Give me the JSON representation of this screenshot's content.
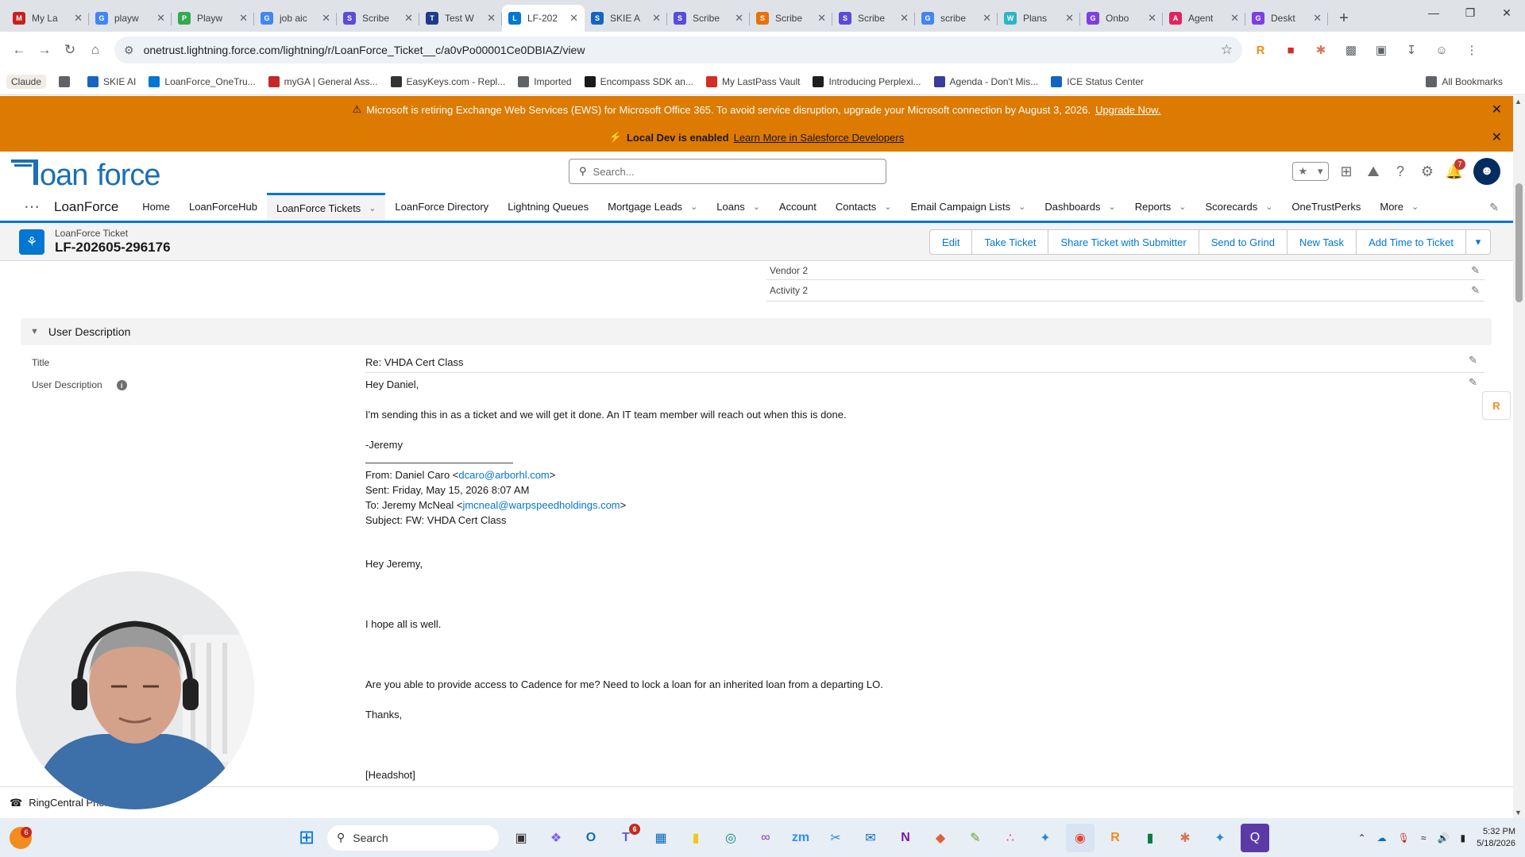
{
  "browser": {
    "tabs": [
      {
        "label": "My La",
        "color": "#c5221f",
        "glyph": "M"
      },
      {
        "label": "playw",
        "color": "#4285f4",
        "glyph": "G"
      },
      {
        "label": "Playw",
        "color": "#34a853",
        "glyph": "P"
      },
      {
        "label": "job aic",
        "color": "#4285f4",
        "glyph": "G"
      },
      {
        "label": "Scribe",
        "color": "#5b4bdb",
        "glyph": "S"
      },
      {
        "label": "Test W",
        "color": "#1e3a8a",
        "glyph": "T"
      },
      {
        "label": "LF-202",
        "color": "#0176d3",
        "glyph": "L",
        "active": true
      },
      {
        "label": "SKIE A",
        "color": "#1565c0",
        "glyph": "S"
      },
      {
        "label": "Scribe",
        "color": "#5b4bdb",
        "glyph": "S"
      },
      {
        "label": "Scribe",
        "color": "#e8710a",
        "glyph": "S"
      },
      {
        "label": "Scribe",
        "color": "#5b4bdb",
        "glyph": "S"
      },
      {
        "label": "scribe",
        "color": "#4285f4",
        "glyph": "G"
      },
      {
        "label": "Plans",
        "color": "#2bb5c9",
        "glyph": "W"
      },
      {
        "label": "Onbo",
        "color": "#7b3fe4",
        "glyph": "G"
      },
      {
        "label": "Agent",
        "color": "#e0245e",
        "glyph": "A"
      },
      {
        "label": "Deskt",
        "color": "#7b3fe4",
        "glyph": "G"
      }
    ],
    "url": "onetrust.lightning.force.com/lightning/r/LoanForce_Ticket__c/a0vPo00001Ce0DBIAZ/view",
    "bookmarks": [
      {
        "label": "Claude",
        "color": "#d97757"
      },
      {
        "label": "",
        "color": "#5f6368"
      },
      {
        "label": "SKIE AI",
        "color": "#1565c0"
      },
      {
        "label": "LoanForce_OneTru...",
        "color": "#0176d3"
      },
      {
        "label": "myGA | General Ass...",
        "color": "#c62828"
      },
      {
        "label": "EasyKeys.com - Repl...",
        "color": "#333333"
      },
      {
        "label": "Imported",
        "color": "#5f6368"
      },
      {
        "label": "Encompass SDK an...",
        "color": "#1a1a1a"
      },
      {
        "label": "My LastPass Vault",
        "color": "#d32d27"
      },
      {
        "label": "Introducing Perplexi...",
        "color": "#1f1f1f"
      },
      {
        "label": "Agenda - Don't Mis...",
        "color": "#3b3b98"
      },
      {
        "label": "ICE Status Center",
        "color": "#1565c0"
      }
    ],
    "all_bookmarks": "All Bookmarks"
  },
  "banners": {
    "ews_text": "Microsoft is retiring Exchange Web Services (EWS) for Microsoft Office 365. To avoid service disruption, upgrade your Microsoft connection by August 3, 2026.",
    "ews_link": "Upgrade Now.",
    "dev_label": "Local Dev is enabled",
    "dev_link": "Learn More in Salesforce Developers"
  },
  "header": {
    "search_placeholder": "Search...",
    "notifications_count": "7"
  },
  "nav": {
    "app_name": "LoanForce",
    "items": [
      {
        "label": "Home",
        "chev": false
      },
      {
        "label": "LoanForceHub",
        "chev": false
      },
      {
        "label": "LoanForce Tickets",
        "chev": true,
        "active": true
      },
      {
        "label": "LoanForce Directory",
        "chev": false
      },
      {
        "label": "Lightning Queues",
        "chev": false
      },
      {
        "label": "Mortgage Leads",
        "chev": true
      },
      {
        "label": "Loans",
        "chev": true
      },
      {
        "label": "Account",
        "chev": false
      },
      {
        "label": "Contacts",
        "chev": true
      },
      {
        "label": "Email Campaign Lists",
        "chev": true
      },
      {
        "label": "Dashboards",
        "chev": true
      },
      {
        "label": "Reports",
        "chev": true
      },
      {
        "label": "Scorecards",
        "chev": true
      },
      {
        "label": "OneTrustPerks",
        "chev": false
      },
      {
        "label": "More",
        "chev": true
      }
    ]
  },
  "record": {
    "type": "LoanForce Ticket",
    "name": "LF-202605-296176",
    "actions": [
      "Edit",
      "Take Ticket",
      "Share Ticket with Submitter",
      "Send to Grind",
      "New Task",
      "Add Time to Ticket"
    ]
  },
  "fields_top": [
    {
      "label": "Vendor 2"
    },
    {
      "label": "Activity 2"
    }
  ],
  "section": {
    "title": "User Description",
    "title_label": "Title",
    "title_value": "Re: VHDA Cert Class",
    "desc_label": "User Description",
    "body": {
      "greeting": "Hey Daniel,",
      "line1": "I'm sending this in as a ticket and we will get it done. An IT team member will reach out when this is done.",
      "sign": "-Jeremy",
      "from_prefix": "From: Daniel Caro <",
      "from_email": "dcaro@arborhl.com",
      "from_suffix": ">",
      "sent": "Sent: Friday, May 15, 2026 8:07 AM",
      "to_prefix": "To: Jeremy McNeal <",
      "to_email": "jmcneal@warpspeedholdings.com",
      "to_suffix": ">",
      "subject": "Subject: FW: VHDA Cert Class",
      "greeting2": "Hey Jeremy,",
      "hope": "I hope all is well.",
      "question": "Are you able to provide access to Cadence for me? Need to lock a loan for an inherited loan from a departing LO.",
      "thanks": "Thanks,",
      "headshot": "[Headshot]"
    }
  },
  "utility": {
    "phone_label": "RingCentral Phone"
  },
  "taskbar": {
    "search_label": "Search",
    "time": "5:32 PM",
    "date": "5/18/2026",
    "teams_badge": "6",
    "firefox_badge": "6"
  }
}
